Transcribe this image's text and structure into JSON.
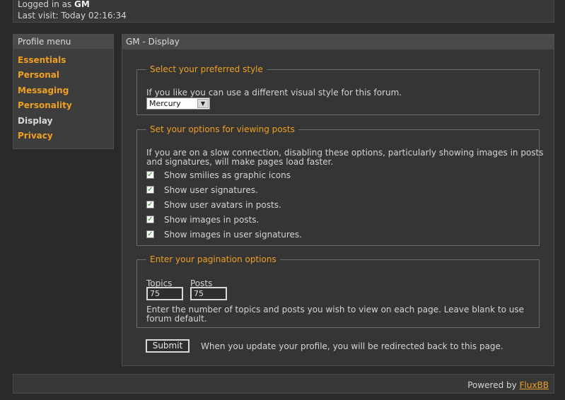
{
  "header": {
    "logged_in_prefix": "Logged in as ",
    "username": "GM",
    "last_visit": "Last visit: Today 02:16:34"
  },
  "sidebar": {
    "title": "Profile menu",
    "items": [
      {
        "label": "Essentials",
        "active": false
      },
      {
        "label": "Personal",
        "active": false
      },
      {
        "label": "Messaging",
        "active": false
      },
      {
        "label": "Personality",
        "active": false
      },
      {
        "label": "Display",
        "active": true
      },
      {
        "label": "Privacy",
        "active": false
      }
    ]
  },
  "main": {
    "title": "GM - Display",
    "style_section": {
      "legend": "Select your preferred style",
      "description": "If you like you can use a different visual style for this forum.",
      "selected_style": "Mercury"
    },
    "viewing_section": {
      "legend": "Set your options for viewing posts",
      "description_line1": "If you are on a slow connection, disabling these options, particularly showing images in posts",
      "description_line2": "and signatures, will make pages load faster.",
      "options": [
        {
          "label": "Show smilies as graphic icons",
          "checked": true
        },
        {
          "label": "Show user signatures.",
          "checked": true
        },
        {
          "label": "Show user avatars in posts.",
          "checked": true
        },
        {
          "label": "Show images in posts.",
          "checked": true
        },
        {
          "label": "Show images in user signatures.",
          "checked": true
        }
      ]
    },
    "pagination_section": {
      "legend": "Enter your pagination options",
      "topics_label": "Topics",
      "topics_value": "75",
      "posts_label": "Posts",
      "posts_value": "75",
      "note_line1": "Enter the number of topics and posts you wish to view on each page. Leave blank to use",
      "note_line2": "forum default."
    },
    "submit_label": "Submit",
    "submit_note": "When you update your profile, you will be redirected back to this page."
  },
  "footer": {
    "powered_prefix": "Powered by ",
    "powered_link": "FluxBB"
  },
  "colors": {
    "accent": "#f0a020",
    "background": "#2a2a2a",
    "panel": "#353535"
  }
}
